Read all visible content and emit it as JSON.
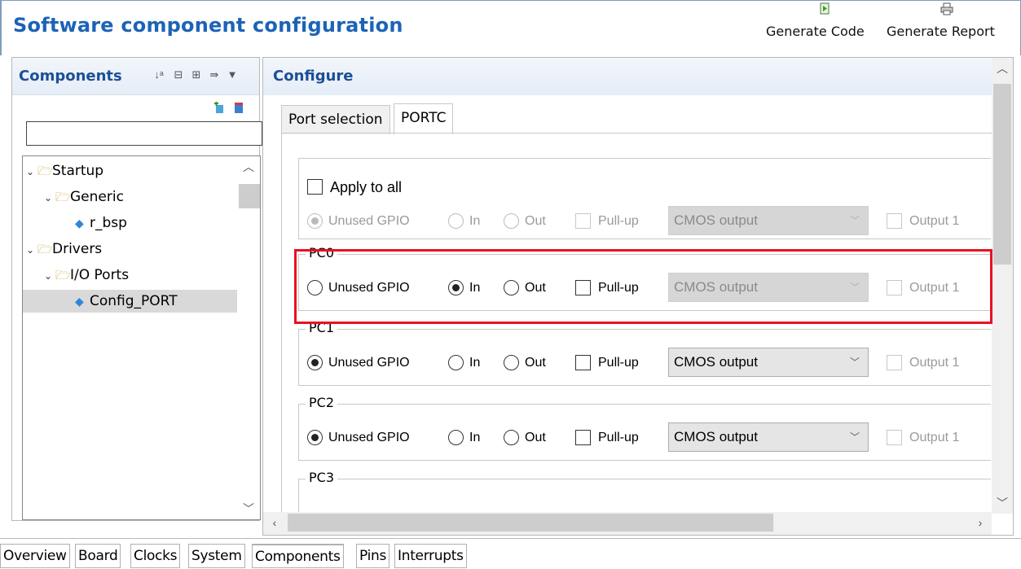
{
  "header": {
    "title": "Software component configuration",
    "generate_code": "Generate Code",
    "generate_report": "Generate Report"
  },
  "components_panel": {
    "title": "Components",
    "filter_value": "",
    "tree": [
      {
        "label": "Startup",
        "level": 0,
        "type": "folder",
        "expanded": true
      },
      {
        "label": "Generic",
        "level": 1,
        "type": "folder",
        "expanded": true
      },
      {
        "label": "r_bsp",
        "level": 2,
        "type": "component"
      },
      {
        "label": "Drivers",
        "level": 0,
        "type": "folder",
        "expanded": true
      },
      {
        "label": "I/O Ports",
        "level": 1,
        "type": "folder",
        "expanded": true
      },
      {
        "label": "Config_PORT",
        "level": 2,
        "type": "component",
        "selected": true
      }
    ]
  },
  "configure_panel": {
    "title": "Configure",
    "tabs": [
      "Port selection",
      "PORTC"
    ],
    "active_tab": "PORTC",
    "apply_to_all": {
      "label": "Apply to all",
      "checked": false
    },
    "options": {
      "unused": "Unused GPIO",
      "in": "In",
      "out": "Out",
      "pullup": "Pull-up",
      "output_type": "CMOS output",
      "output1": "Output 1"
    },
    "pins": [
      {
        "name": "PC0",
        "mode": "In",
        "pullup": false,
        "output_type": "CMOS output",
        "output1": false,
        "highlighted": true
      },
      {
        "name": "PC1",
        "mode": "Unused GPIO",
        "pullup": false,
        "output_type": "CMOS output",
        "output1": false
      },
      {
        "name": "PC2",
        "mode": "Unused GPIO",
        "pullup": false,
        "output_type": "CMOS output",
        "output1": false
      },
      {
        "name": "PC3"
      }
    ]
  },
  "bottom_tabs": [
    "Overview",
    "Board",
    "Clocks",
    "System",
    "Components",
    "Pins",
    "Interrupts"
  ],
  "active_bottom_tab": "Components",
  "colors": {
    "title_blue": "#1c63b7",
    "highlight_red": "#e81123"
  }
}
